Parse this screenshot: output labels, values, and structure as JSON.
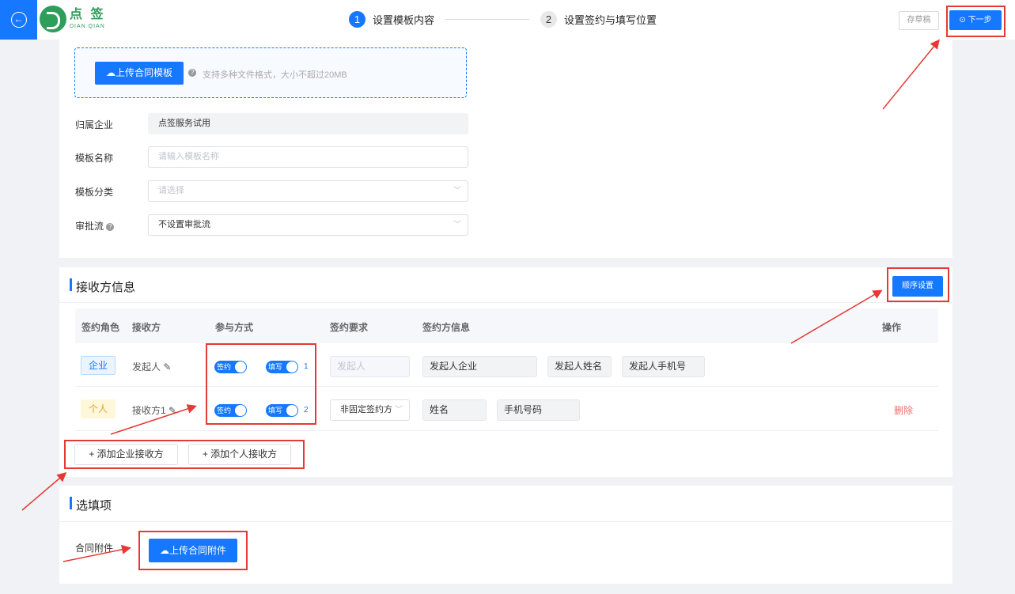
{
  "header": {
    "logo_cn": "点 签",
    "logo_en": "DIAN QIAN",
    "steps": [
      {
        "num": "1",
        "label": "设置模板内容"
      },
      {
        "num": "2",
        "label": "设置签约与填写位置"
      }
    ],
    "draft_label": "存草稿",
    "next_label": "下一步"
  },
  "template": {
    "upload_label": "上传合同模板",
    "upload_hint": "支持多种文件格式，大小不超过20MB",
    "fields": {
      "company": {
        "label": "归属企业",
        "value": "点签服务试用"
      },
      "name": {
        "label": "模板名称",
        "placeholder": "请输入模板名称"
      },
      "category": {
        "label": "模板分类",
        "placeholder": "请选择"
      },
      "approval": {
        "label": "审批流",
        "value": "不设置审批流"
      }
    }
  },
  "recipients": {
    "title": "接收方信息",
    "order_button": "顺序设置",
    "columns": [
      "签约角色",
      "接收方",
      "参与方式",
      "签约要求",
      "签约方信息",
      "操作"
    ],
    "rows": [
      {
        "role": "企业",
        "name": "发起人",
        "sign_label": "签约",
        "fill_label": "填写",
        "fill_order": "1",
        "requirement": "发起人",
        "info": [
          "发起人企业",
          "发起人姓名",
          "发起人手机号"
        ],
        "action": ""
      },
      {
        "role": "个人",
        "name": "接收方1",
        "sign_label": "签约",
        "fill_label": "填写",
        "fill_order": "2",
        "requirement": "非固定签约方",
        "info": [
          "姓名",
          "手机号码"
        ],
        "action": "删除"
      }
    ],
    "add_company": "+ 添加企业接收方",
    "add_person": "+ 添加个人接收方"
  },
  "optional": {
    "title": "选填项",
    "attachment_label": "合同附件",
    "upload_label": "上传合同附件"
  },
  "colors": {
    "primary": "#1677ff",
    "annotation": "#e53935",
    "delete": "#f56c6c"
  }
}
